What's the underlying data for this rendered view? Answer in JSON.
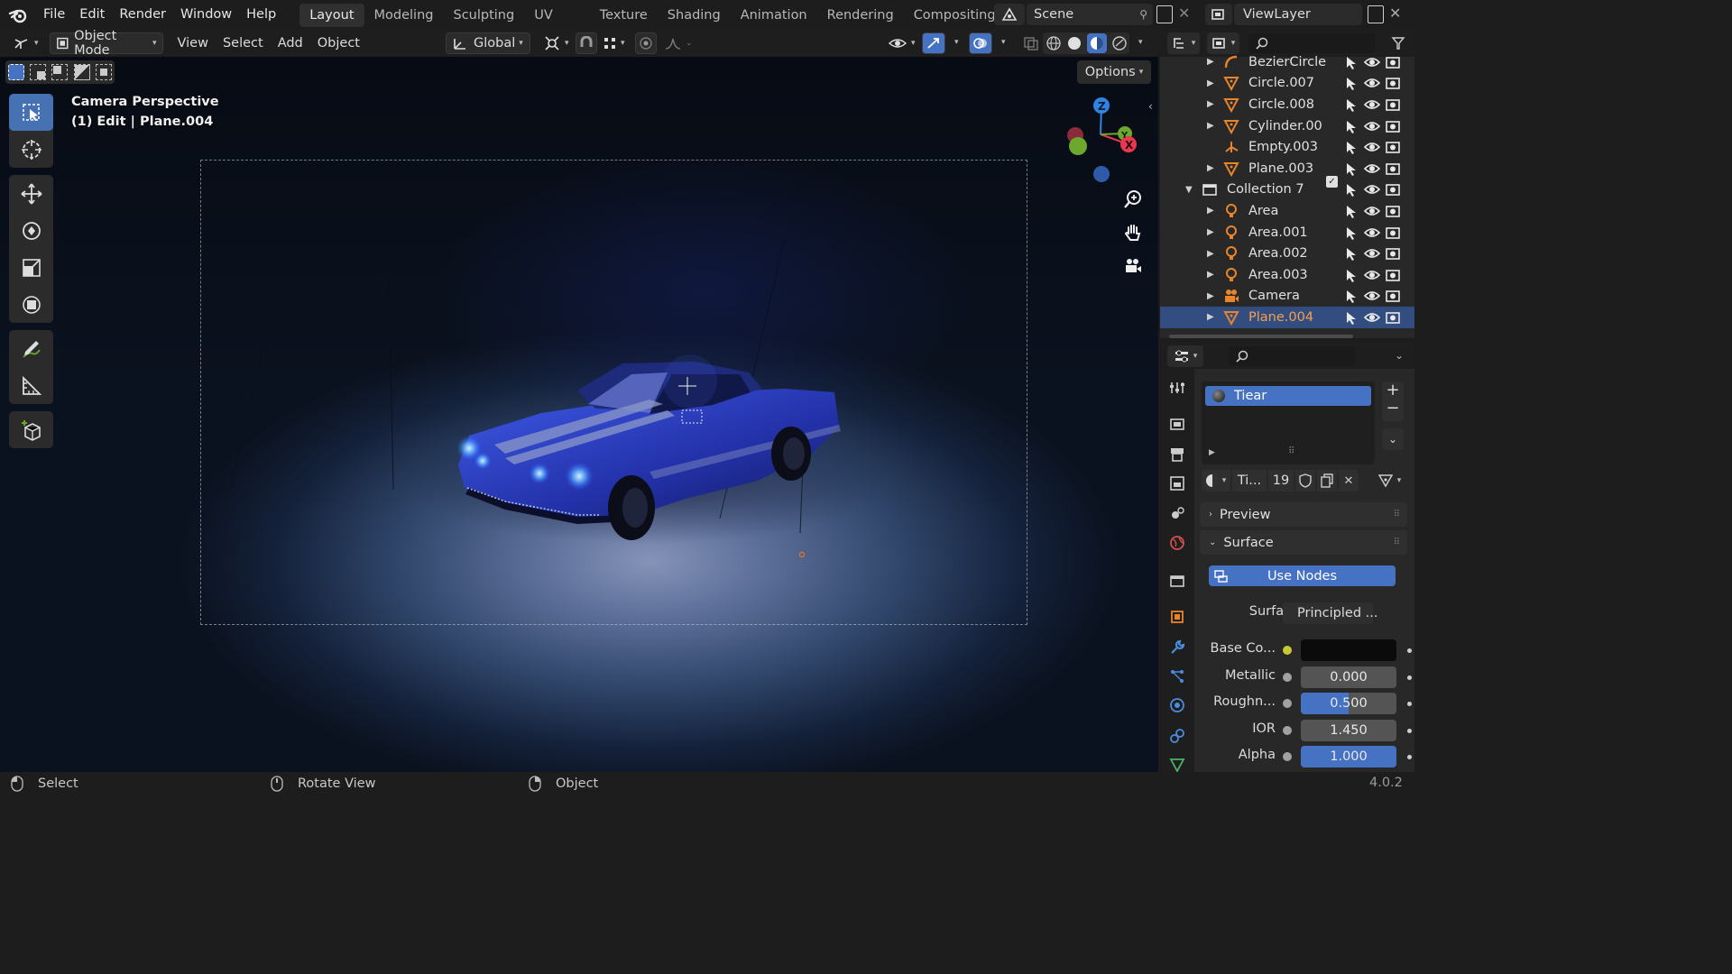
{
  "topbar": {
    "menus": [
      "File",
      "Edit",
      "Render",
      "Window",
      "Help"
    ],
    "workspaces": [
      "Layout",
      "Modeling",
      "Sculpting",
      "UV Editing",
      "Texture Paint",
      "Shading",
      "Animation",
      "Rendering",
      "Compositing"
    ],
    "active_workspace": "Layout",
    "scene_name": "Scene",
    "view_layer": "ViewLayer"
  },
  "viewport_header": {
    "mode": "Object Mode",
    "menus": [
      "View",
      "Select",
      "Add",
      "Object"
    ],
    "orientation": "Global",
    "options_label": "Options"
  },
  "viewport": {
    "overlay_line1": "Camera Perspective",
    "overlay_line2": "(1) Edit | Plane.004",
    "gizmo_axes": {
      "z": "Z",
      "y": "Y",
      "x": "X"
    }
  },
  "outliner": {
    "rows": [
      {
        "label": "BezierCircle",
        "icon": "curve-icon",
        "indent": 1,
        "arrow": "▶"
      },
      {
        "label": "Circle.007",
        "icon": "mesh-icon",
        "indent": 1,
        "arrow": "▶"
      },
      {
        "label": "Circle.008",
        "icon": "mesh-icon",
        "indent": 1,
        "arrow": "▶"
      },
      {
        "label": "Cylinder.00",
        "icon": "mesh-icon",
        "indent": 1,
        "arrow": "▶"
      },
      {
        "label": "Empty.003",
        "icon": "empty-icon",
        "indent": 1,
        "arrow": ""
      },
      {
        "label": "Plane.003",
        "icon": "mesh-icon",
        "indent": 1,
        "arrow": "▶"
      },
      {
        "label": "Collection 7",
        "icon": "collection-icon",
        "indent": 0,
        "arrow": "▼"
      },
      {
        "label": "Area",
        "icon": "light-icon",
        "indent": 1,
        "arrow": "▶"
      },
      {
        "label": "Area.001",
        "icon": "light-icon",
        "indent": 1,
        "arrow": "▶"
      },
      {
        "label": "Area.002",
        "icon": "light-icon",
        "indent": 1,
        "arrow": "▶"
      },
      {
        "label": "Area.003",
        "icon": "light-icon",
        "indent": 1,
        "arrow": "▶"
      },
      {
        "label": "Camera",
        "icon": "camera-icon",
        "indent": 1,
        "arrow": "▶"
      },
      {
        "label": "Plane.004",
        "icon": "mesh-icon",
        "indent": 1,
        "arrow": "▶",
        "selected": true
      }
    ]
  },
  "properties": {
    "material_slot": "Tiear",
    "material_name": "Ti...",
    "user_count": "19",
    "panels": {
      "preview": "Preview",
      "surface": "Surface"
    },
    "use_nodes_label": "Use Nodes",
    "surface_label": "Surface",
    "surface_value": "Principled ...",
    "fields": [
      {
        "label": "Base Co...",
        "value": "",
        "type": "color",
        "socket": "#c8c832"
      },
      {
        "label": "Metallic",
        "value": "0.000",
        "type": "num",
        "socket": "#a1a1a1",
        "fill": 0
      },
      {
        "label": "Roughn...",
        "value": "0.500",
        "type": "num",
        "socket": "#a1a1a1",
        "fill": 0.5
      },
      {
        "label": "IOR",
        "value": "1.450",
        "type": "num",
        "socket": "#a1a1a1",
        "fill": 0
      },
      {
        "label": "Alpha",
        "value": "1.000",
        "type": "num",
        "socket": "#a1a1a1",
        "fill": 1
      }
    ]
  },
  "statusbar": {
    "left": "Select",
    "middle": "Rotate View",
    "right": "Object",
    "version": "4.0.2"
  },
  "colors": {
    "accent": "#4672c4",
    "selected_row": "#334d80",
    "selected_text": "#f2a050",
    "axis_x": "#e8384f",
    "axis_y": "#6ba82d",
    "axis_z": "#2f83e3"
  }
}
